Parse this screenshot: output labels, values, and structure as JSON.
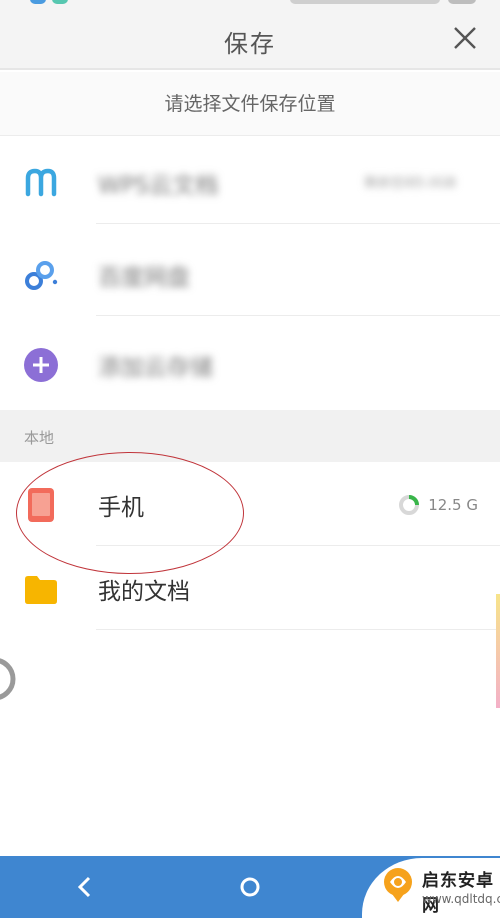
{
  "header": {
    "title": "保存"
  },
  "subtitle": "请选择文件保存位置",
  "cloud_items": [
    {
      "label": "WPS云文档",
      "meta": "剩余空间5.0GB"
    },
    {
      "label": "百度网盘"
    },
    {
      "label": "添加云存储"
    }
  ],
  "local_section": {
    "title": "本地"
  },
  "local_items": [
    {
      "label": "手机",
      "storage": "12.5 G"
    },
    {
      "label": "我的文档"
    }
  ],
  "colors": {
    "header_bg": "#f4f4f4",
    "navbar_bg": "#3f86d0",
    "wps_icon": "#3ba7e0",
    "baidu_icon": "#3c7fd9",
    "add_icon": "#8c6fd6",
    "phone_icon": "#f26b5b",
    "folder_icon": "#f7b500",
    "annotation": "#c0343a"
  },
  "icons": {
    "close": "close-icon",
    "wps": "wps-cloud-icon",
    "baidu": "baidu-netdisk-icon",
    "add": "plus-circle-icon",
    "phone": "phone-icon",
    "folder": "folder-icon",
    "back": "back-icon",
    "home": "home-icon"
  },
  "watermark": {
    "name": "启东安卓网",
    "url": "www.qdltdq.com"
  }
}
